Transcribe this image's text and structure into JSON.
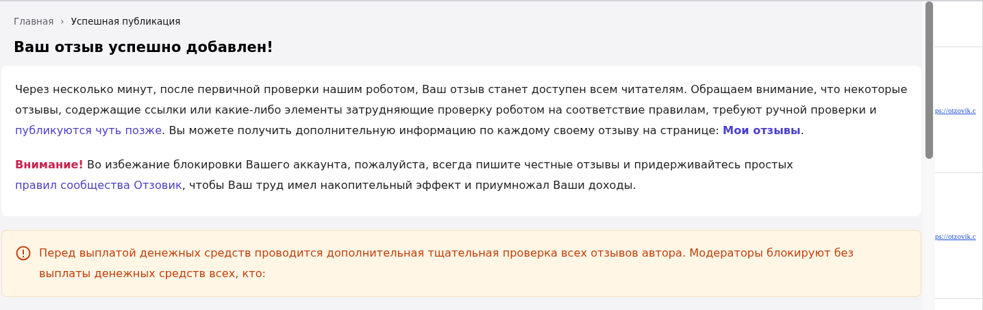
{
  "breadcrumbs": [
    {
      "label": "Главная",
      "kind": "link"
    },
    {
      "label": "Успешная публикация",
      "kind": "current"
    }
  ],
  "breadcrumb_separator": "›",
  "title": "Ваш отзыв успешно добавлен!",
  "notice": {
    "paragraphs": [
      [
        {
          "text": "Через несколько минут, после первичной проверки нашим роботом, Ваш отзыв станет доступен всем читателям. Обращаем внимание, что некоторые отзывы, содержащие ссылки или какие-либо элементы затрудняющие проверку роботом на соответствие правилам, требуют ручной проверки и ",
          "kind": "text"
        },
        {
          "text": "публикуются чуть позже",
          "kind": "link"
        },
        {
          "text": ". Вы можете получить дополнительную информацию по каждому своему отзыву на странице: ",
          "kind": "text"
        },
        {
          "text": "Мои отзывы",
          "kind": "bold-link"
        },
        {
          "text": ".",
          "kind": "text"
        }
      ],
      [
        {
          "text": "Внимание!",
          "kind": "warning"
        },
        {
          "text": " Во избежание блокировки Вашего аккаунта, пожалуйста, всегда пишите честные отзывы и придерживайтесь простых ",
          "kind": "text"
        },
        {
          "text": "правил сообщества Отзовик",
          "kind": "link"
        },
        {
          "text": ", чтобы Ваш труд имел накопительный эффект и приумножал Ваши доходы.",
          "kind": "text"
        }
      ]
    ]
  },
  "alert": {
    "text": "Перед выплатой денежных средств проводится дополнительная тщательная проверка всех отзывов автора. Модераторы блокируют без выплаты денежных средств всех, кто:"
  },
  "side_links": [
    "ps://otzovik.c",
    "ps://otzovik.c"
  ]
}
